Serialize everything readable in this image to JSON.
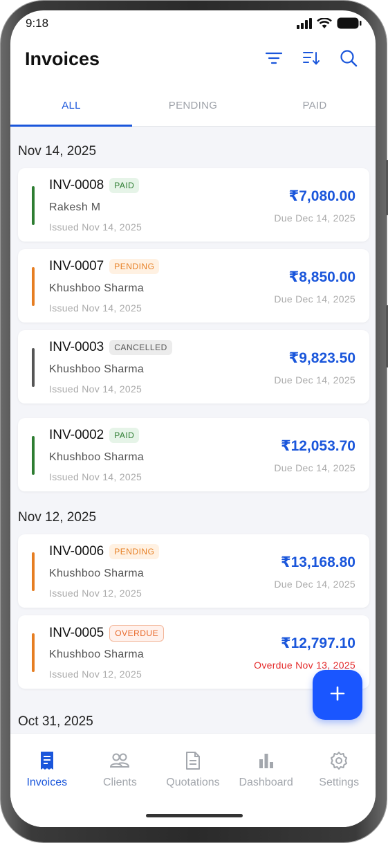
{
  "status_bar": {
    "time": "9:18"
  },
  "header": {
    "title": "Invoices"
  },
  "tabs": [
    {
      "label": "ALL",
      "active": true
    },
    {
      "label": "PENDING",
      "active": false
    },
    {
      "label": "PAID",
      "active": false
    }
  ],
  "groups": [
    {
      "date": "Nov 14, 2025",
      "invoices": [
        {
          "number": "INV-0008",
          "status": "PAID",
          "client": "Rakesh M",
          "issued": "Issued Nov 14, 2025",
          "amount": "₹7,080.00",
          "due": "Due Dec 14, 2025"
        },
        {
          "number": "INV-0007",
          "status": "PENDING",
          "client": "Khushboo Sharma",
          "issued": "Issued Nov 14, 2025",
          "amount": "₹8,850.00",
          "due": "Due Dec 14, 2025"
        },
        {
          "number": "INV-0003",
          "status": "CANCELLED",
          "client": "Khushboo Sharma",
          "issued": "Issued Nov 14, 2025",
          "amount": "₹9,823.50",
          "due": "Due Dec 14, 2025"
        },
        {
          "number": "INV-0002",
          "status": "PAID",
          "client": "Khushboo Sharma",
          "issued": "Issued Nov 14, 2025",
          "amount": "₹12,053.70",
          "due": "Due Dec 14, 2025"
        }
      ]
    },
    {
      "date": "Nov 12, 2025",
      "invoices": [
        {
          "number": "INV-0006",
          "status": "PENDING",
          "client": "Khushboo Sharma",
          "issued": "Issued Nov 12, 2025",
          "amount": "₹13,168.80",
          "due": "Due Dec 14, 2025"
        },
        {
          "number": "INV-0005",
          "status": "OVERDUE",
          "client": "Khushboo Sharma",
          "issued": "Issued Nov 12, 2025",
          "amount": "₹12,797.10",
          "due": "Overdue Nov 13, 2025"
        }
      ]
    },
    {
      "date": "Oct 31, 2025",
      "invoices": []
    }
  ],
  "status_colors": {
    "PAID": "#2e7d32",
    "PENDING": "#e67e22",
    "CANCELLED": "#555555",
    "OVERDUE": "#e8692a"
  },
  "accent_color": "#1a56db",
  "fab": {
    "icon": "plus-icon"
  },
  "bottom_nav": [
    {
      "label": "Invoices",
      "icon": "invoice-icon",
      "active": true
    },
    {
      "label": "Clients",
      "icon": "users-icon",
      "active": false
    },
    {
      "label": "Quotations",
      "icon": "document-icon",
      "active": false
    },
    {
      "label": "Dashboard",
      "icon": "bar-chart-icon",
      "active": false
    },
    {
      "label": "Settings",
      "icon": "gear-icon",
      "active": false
    }
  ]
}
